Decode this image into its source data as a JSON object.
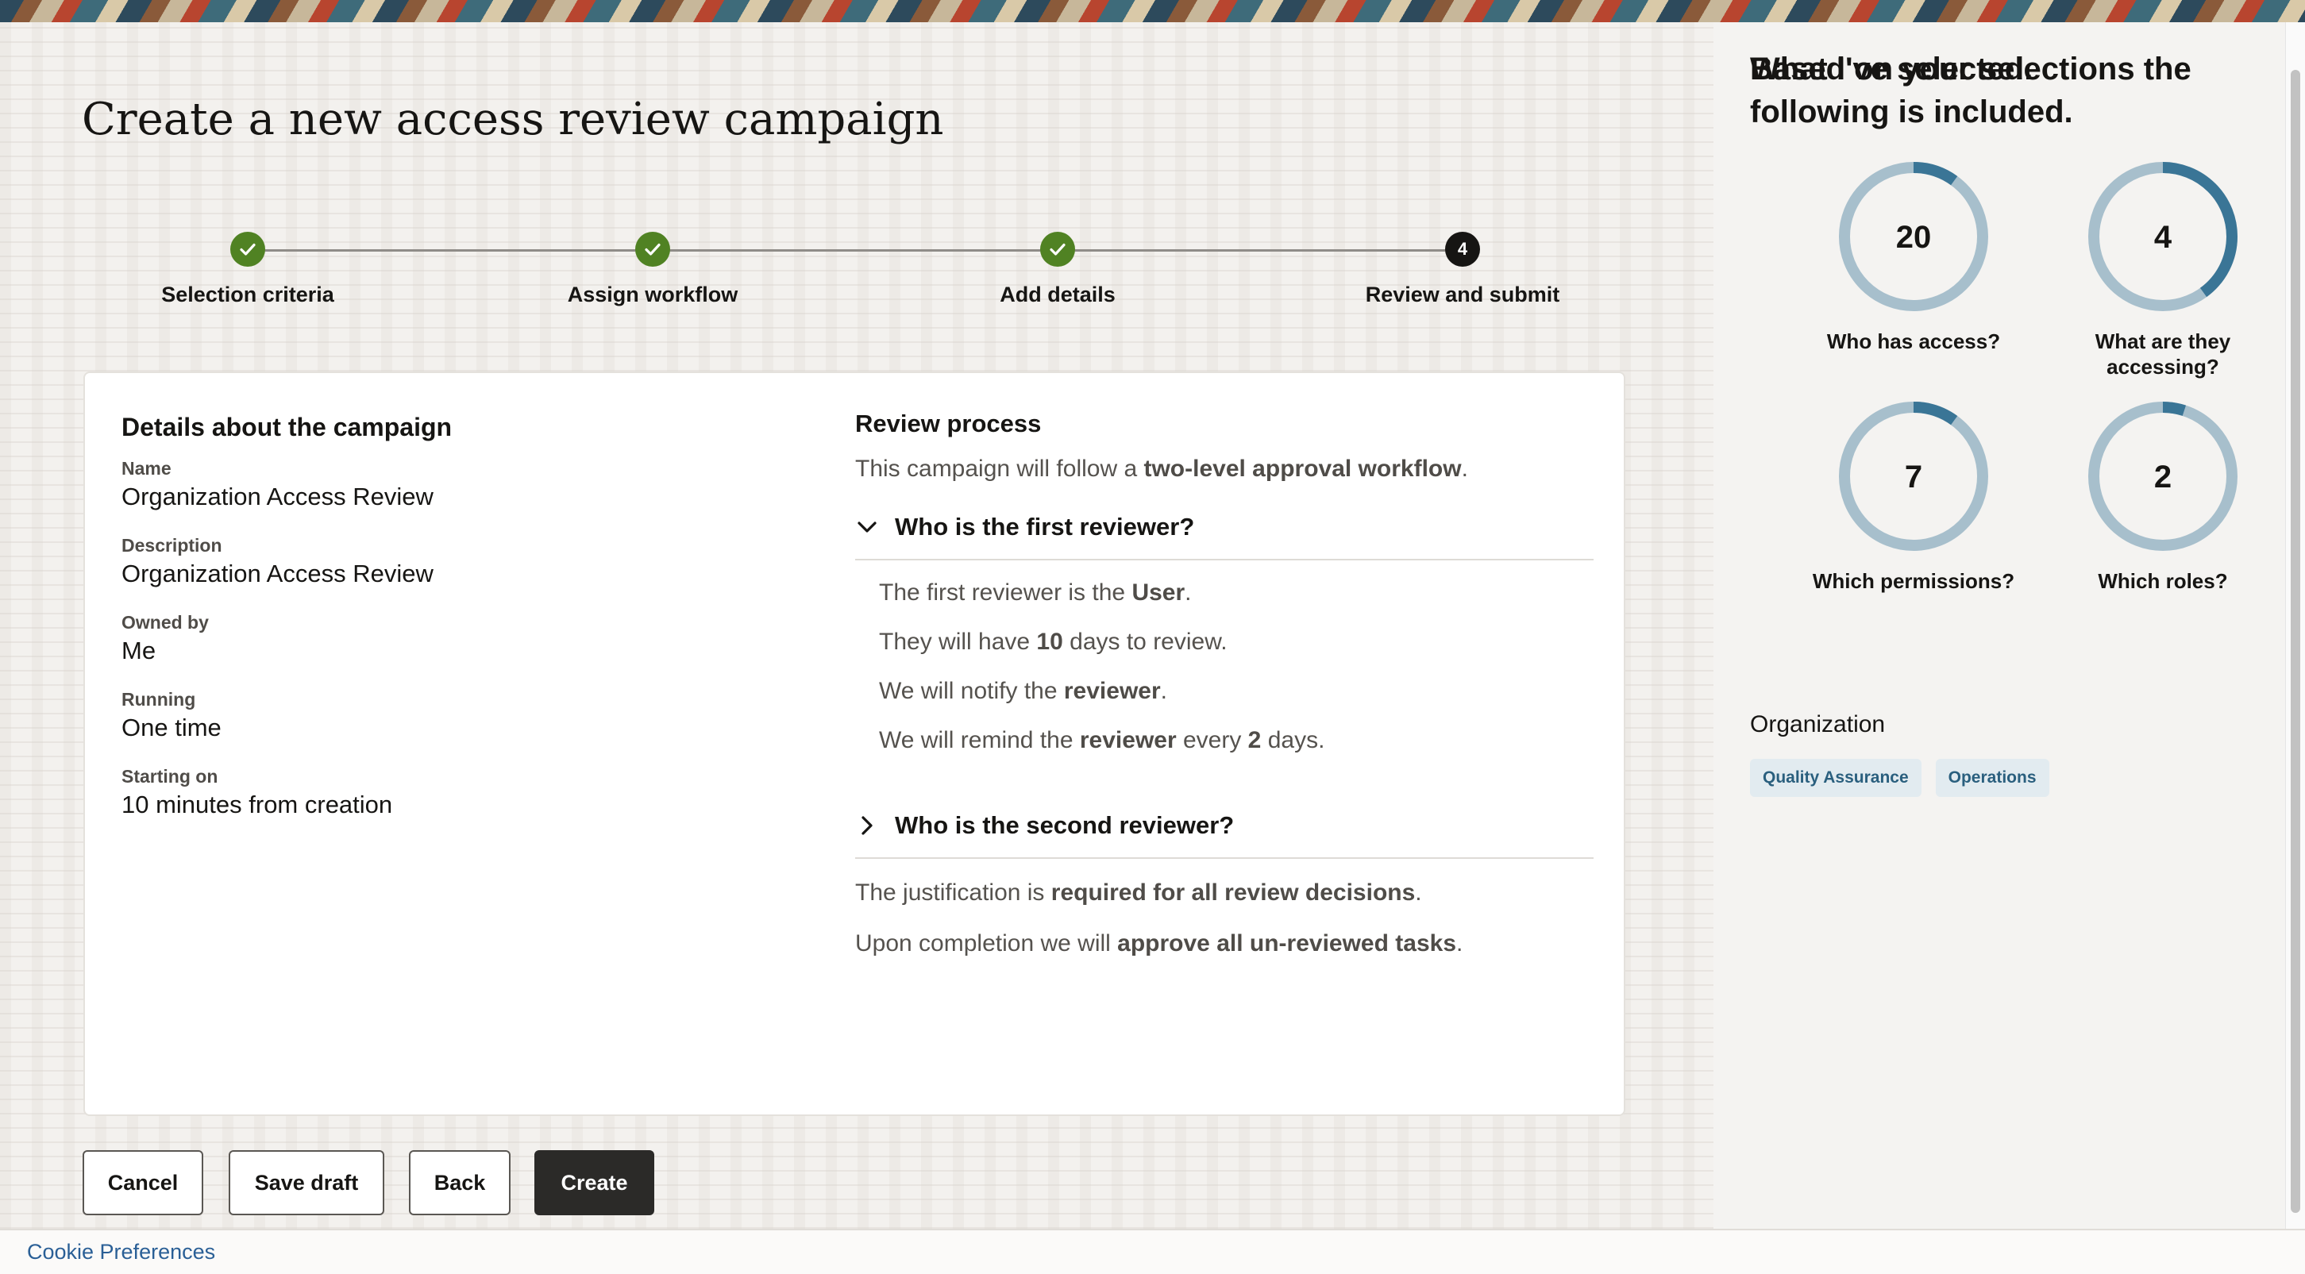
{
  "page_title": "Create a new access review campaign",
  "steps": [
    {
      "label": "Selection criteria",
      "status": "done",
      "number": "1"
    },
    {
      "label": "Assign workflow",
      "status": "done",
      "number": "2"
    },
    {
      "label": "Add details",
      "status": "done",
      "number": "3"
    },
    {
      "label": "Review and submit",
      "status": "current",
      "number": "4"
    }
  ],
  "details": {
    "heading": "Details about the campaign",
    "fields": [
      {
        "label": "Name",
        "value": "Organization Access Review"
      },
      {
        "label": "Description",
        "value": "Organization Access Review"
      },
      {
        "label": "Owned by",
        "value": "Me"
      },
      {
        "label": "Running",
        "value": "One time"
      },
      {
        "label": "Starting on",
        "value": "10 minutes from creation"
      }
    ]
  },
  "review": {
    "heading": "Review process",
    "intro_pre": "This campaign will follow a ",
    "intro_bold": "two-level approval workflow",
    "intro_post": ".",
    "first": {
      "title": "Who is the first reviewer?",
      "expanded": true,
      "l1_pre": "The first reviewer is the ",
      "l1_bold": "User",
      "l1_post": ".",
      "l2_pre": "They will have ",
      "l2_bold": "10",
      "l2_post": " days to review.",
      "l3_pre": "We will notify the ",
      "l3_bold": "reviewer",
      "l3_post": ".",
      "l4_pre": "We will remind the ",
      "l4_bold1": "reviewer",
      "l4_mid": " every ",
      "l4_bold2": "2",
      "l4_post": " days."
    },
    "second": {
      "title": "Who is the second reviewer?",
      "expanded": false
    },
    "justification_pre": "The justification is ",
    "justification_bold": "required for all review decisions",
    "justification_post": ".",
    "completion_pre": "Upon completion we will ",
    "completion_bold": "approve all un-reviewed tasks",
    "completion_post": "."
  },
  "buttons": {
    "cancel": "Cancel",
    "save_draft": "Save draft",
    "back": "Back",
    "create": "Create"
  },
  "summary": {
    "heading": "Based on your selections the following is included.",
    "rings": [
      {
        "value": "20",
        "label": "Who has access?",
        "fraction": 0.1
      },
      {
        "value": "4",
        "label": "What are they accessing?",
        "fraction": 0.4
      },
      {
        "value": "7",
        "label": "Which permissions?",
        "fraction": 0.1
      },
      {
        "value": "2",
        "label": "Which roles?",
        "fraction": 0.05
      }
    ],
    "ring_colors": {
      "track": "#a7bfcc",
      "fill": "#3a7596"
    },
    "selected_heading": "What I've selected.",
    "org_label": "Organization",
    "chips": [
      "Quality Assurance",
      "Operations"
    ]
  },
  "footer": {
    "cookie_link": "Cookie Preferences"
  }
}
